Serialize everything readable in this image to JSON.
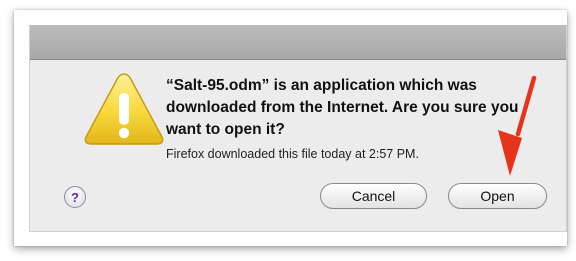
{
  "dialog": {
    "message": "“Salt-95.odm” is an application which was downloaded from the Internet. Are you sure you want to open it?",
    "info": "Firefox downloaded this file today at 2:57 PM.",
    "help_label": "?",
    "cancel_label": "Cancel",
    "open_label": "Open"
  },
  "icons": {
    "warning": "warning-triangle-icon",
    "help": "help-icon",
    "annotation": "red-arrow"
  },
  "colors": {
    "warning_fill": "#f6d53a",
    "annotation_arrow": "#e8331c",
    "help_glyph": "#5a2ca0"
  }
}
